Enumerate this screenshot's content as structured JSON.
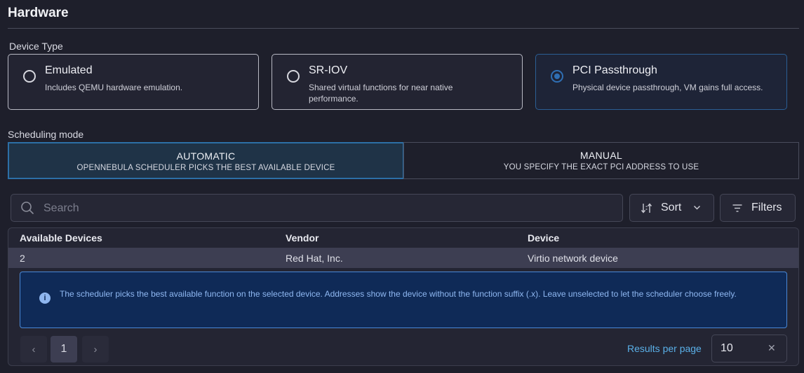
{
  "header": {
    "title": "Hardware"
  },
  "device_type": {
    "label": "Device Type",
    "selected": "PCI Passthrough",
    "options": [
      {
        "title": "Emulated",
        "description": "Includes QEMU hardware emulation."
      },
      {
        "title": "SR-IOV",
        "description": "Shared virtual functions for near native performance."
      },
      {
        "title": "PCI Passthrough",
        "description": "Physical device passthrough, VM gains full access."
      }
    ]
  },
  "scheduling": {
    "label": "Scheduling mode",
    "selected": "AUTOMATIC",
    "options": [
      {
        "title": "AUTOMATIC",
        "subtitle": "OPENNEBULA SCHEDULER PICKS THE BEST AVAILABLE DEVICE"
      },
      {
        "title": "MANUAL",
        "subtitle": "YOU SPECIFY THE EXACT PCI ADDRESS TO USE"
      }
    ]
  },
  "toolbar": {
    "search_placeholder": "Search",
    "sort_label": "Sort",
    "filters_label": "Filters"
  },
  "table": {
    "columns": [
      "Available Devices",
      "Vendor",
      "Device"
    ],
    "rows": [
      {
        "available": "2",
        "vendor": "Red Hat, Inc.",
        "device": "Virtio network device"
      }
    ]
  },
  "info": {
    "icon": "info-icon",
    "text": "The scheduler picks the best available function on the selected device. Addresses show the device without the function suffix (.x). Leave unselected to let the scheduler choose freely."
  },
  "pagination": {
    "current_page": "1",
    "prev_icon": "chevron-left-icon",
    "next_icon": "chevron-right-icon",
    "results_per_page_label": "Results per page",
    "results_per_page_value": "10"
  },
  "colors": {
    "background": "#1e1f2b",
    "accent": "#2f6fb4",
    "info_bg": "#0f2a57",
    "info_text": "#8fb8f2",
    "link": "#5ab0e8"
  }
}
